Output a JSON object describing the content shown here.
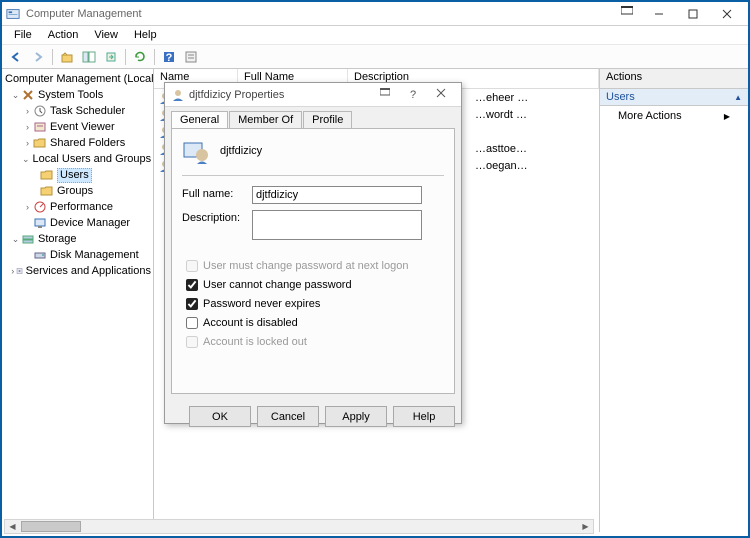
{
  "window": {
    "title": "Computer Management"
  },
  "menubar": [
    "File",
    "Action",
    "View",
    "Help"
  ],
  "tree": {
    "root": "Computer Management (Local)",
    "system_tools": "System Tools",
    "task_scheduler": "Task Scheduler",
    "event_viewer": "Event Viewer",
    "shared_folders": "Shared Folders",
    "local_users": "Local Users and Groups",
    "users": "Users",
    "groups": "Groups",
    "performance": "Performance",
    "device_manager": "Device Manager",
    "storage": "Storage",
    "disk_management": "Disk Management",
    "services_apps": "Services and Applications"
  },
  "list": {
    "columns": {
      "name": "Name",
      "fullname": "Full Name",
      "description": "Description"
    },
    "rows": [
      {
        "desc": "…eheer …"
      },
      {
        "desc": "…wordt …"
      },
      {
        "desc": ""
      },
      {
        "desc": "…asttoe…"
      },
      {
        "desc": "…oegan…"
      }
    ]
  },
  "actions": {
    "header": "Actions",
    "group": "Users",
    "more": "More Actions"
  },
  "dialog": {
    "title": "djtfdizicy Properties",
    "tabs": {
      "general": "General",
      "memberof": "Member Of",
      "profile": "Profile"
    },
    "username": "djtfdizicy",
    "fullname_label": "Full name:",
    "fullname_value": "djtfdizicy",
    "description_label": "Description:",
    "description_value": "",
    "chk_mustchange": "User must change password at next logon",
    "chk_cannotchange": "User cannot change password",
    "chk_neverexpires": "Password never expires",
    "chk_disabled": "Account is disabled",
    "chk_lockedout": "Account is locked out",
    "btn_ok": "OK",
    "btn_cancel": "Cancel",
    "btn_apply": "Apply",
    "btn_help": "Help"
  }
}
